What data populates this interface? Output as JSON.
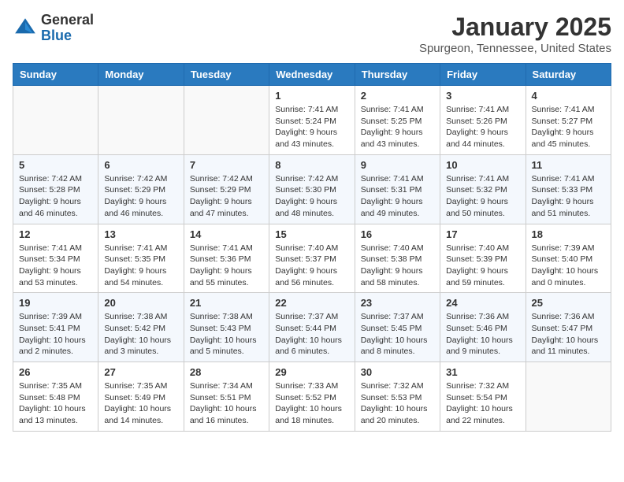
{
  "header": {
    "logo_general": "General",
    "logo_blue": "Blue",
    "month": "January 2025",
    "location": "Spurgeon, Tennessee, United States"
  },
  "weekdays": [
    "Sunday",
    "Monday",
    "Tuesday",
    "Wednesday",
    "Thursday",
    "Friday",
    "Saturday"
  ],
  "weeks": [
    [
      {
        "day": "",
        "info": ""
      },
      {
        "day": "",
        "info": ""
      },
      {
        "day": "",
        "info": ""
      },
      {
        "day": "1",
        "info": "Sunrise: 7:41 AM\nSunset: 5:24 PM\nDaylight: 9 hours and 43 minutes."
      },
      {
        "day": "2",
        "info": "Sunrise: 7:41 AM\nSunset: 5:25 PM\nDaylight: 9 hours and 43 minutes."
      },
      {
        "day": "3",
        "info": "Sunrise: 7:41 AM\nSunset: 5:26 PM\nDaylight: 9 hours and 44 minutes."
      },
      {
        "day": "4",
        "info": "Sunrise: 7:41 AM\nSunset: 5:27 PM\nDaylight: 9 hours and 45 minutes."
      }
    ],
    [
      {
        "day": "5",
        "info": "Sunrise: 7:42 AM\nSunset: 5:28 PM\nDaylight: 9 hours and 46 minutes."
      },
      {
        "day": "6",
        "info": "Sunrise: 7:42 AM\nSunset: 5:29 PM\nDaylight: 9 hours and 46 minutes."
      },
      {
        "day": "7",
        "info": "Sunrise: 7:42 AM\nSunset: 5:29 PM\nDaylight: 9 hours and 47 minutes."
      },
      {
        "day": "8",
        "info": "Sunrise: 7:42 AM\nSunset: 5:30 PM\nDaylight: 9 hours and 48 minutes."
      },
      {
        "day": "9",
        "info": "Sunrise: 7:41 AM\nSunset: 5:31 PM\nDaylight: 9 hours and 49 minutes."
      },
      {
        "day": "10",
        "info": "Sunrise: 7:41 AM\nSunset: 5:32 PM\nDaylight: 9 hours and 50 minutes."
      },
      {
        "day": "11",
        "info": "Sunrise: 7:41 AM\nSunset: 5:33 PM\nDaylight: 9 hours and 51 minutes."
      }
    ],
    [
      {
        "day": "12",
        "info": "Sunrise: 7:41 AM\nSunset: 5:34 PM\nDaylight: 9 hours and 53 minutes."
      },
      {
        "day": "13",
        "info": "Sunrise: 7:41 AM\nSunset: 5:35 PM\nDaylight: 9 hours and 54 minutes."
      },
      {
        "day": "14",
        "info": "Sunrise: 7:41 AM\nSunset: 5:36 PM\nDaylight: 9 hours and 55 minutes."
      },
      {
        "day": "15",
        "info": "Sunrise: 7:40 AM\nSunset: 5:37 PM\nDaylight: 9 hours and 56 minutes."
      },
      {
        "day": "16",
        "info": "Sunrise: 7:40 AM\nSunset: 5:38 PM\nDaylight: 9 hours and 58 minutes."
      },
      {
        "day": "17",
        "info": "Sunrise: 7:40 AM\nSunset: 5:39 PM\nDaylight: 9 hours and 59 minutes."
      },
      {
        "day": "18",
        "info": "Sunrise: 7:39 AM\nSunset: 5:40 PM\nDaylight: 10 hours and 0 minutes."
      }
    ],
    [
      {
        "day": "19",
        "info": "Sunrise: 7:39 AM\nSunset: 5:41 PM\nDaylight: 10 hours and 2 minutes."
      },
      {
        "day": "20",
        "info": "Sunrise: 7:38 AM\nSunset: 5:42 PM\nDaylight: 10 hours and 3 minutes."
      },
      {
        "day": "21",
        "info": "Sunrise: 7:38 AM\nSunset: 5:43 PM\nDaylight: 10 hours and 5 minutes."
      },
      {
        "day": "22",
        "info": "Sunrise: 7:37 AM\nSunset: 5:44 PM\nDaylight: 10 hours and 6 minutes."
      },
      {
        "day": "23",
        "info": "Sunrise: 7:37 AM\nSunset: 5:45 PM\nDaylight: 10 hours and 8 minutes."
      },
      {
        "day": "24",
        "info": "Sunrise: 7:36 AM\nSunset: 5:46 PM\nDaylight: 10 hours and 9 minutes."
      },
      {
        "day": "25",
        "info": "Sunrise: 7:36 AM\nSunset: 5:47 PM\nDaylight: 10 hours and 11 minutes."
      }
    ],
    [
      {
        "day": "26",
        "info": "Sunrise: 7:35 AM\nSunset: 5:48 PM\nDaylight: 10 hours and 13 minutes."
      },
      {
        "day": "27",
        "info": "Sunrise: 7:35 AM\nSunset: 5:49 PM\nDaylight: 10 hours and 14 minutes."
      },
      {
        "day": "28",
        "info": "Sunrise: 7:34 AM\nSunset: 5:51 PM\nDaylight: 10 hours and 16 minutes."
      },
      {
        "day": "29",
        "info": "Sunrise: 7:33 AM\nSunset: 5:52 PM\nDaylight: 10 hours and 18 minutes."
      },
      {
        "day": "30",
        "info": "Sunrise: 7:32 AM\nSunset: 5:53 PM\nDaylight: 10 hours and 20 minutes."
      },
      {
        "day": "31",
        "info": "Sunrise: 7:32 AM\nSunset: 5:54 PM\nDaylight: 10 hours and 22 minutes."
      },
      {
        "day": "",
        "info": ""
      }
    ]
  ]
}
